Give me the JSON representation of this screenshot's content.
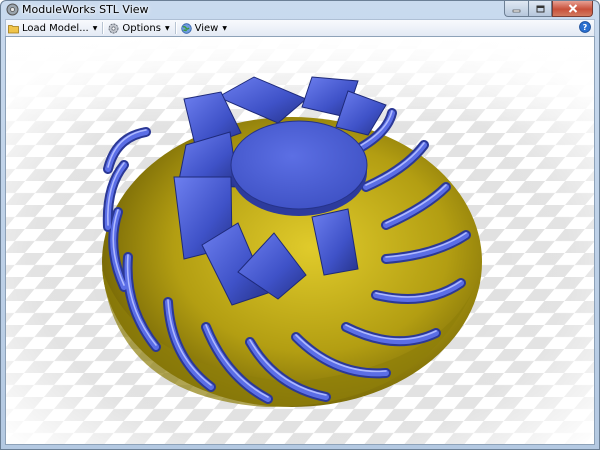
{
  "window": {
    "title": "ModuleWorks STL View"
  },
  "toolbar": {
    "load_model_label": "Load Model...",
    "options_label": "Options",
    "view_label": "View",
    "dropdown_arrow": "▼"
  },
  "icons": {
    "app": "gear-app-icon",
    "load": "folder-icon",
    "options": "gear-icon",
    "view": "globe-icon",
    "help": "help-icon"
  },
  "colors": {
    "blade": "#4a5ed8",
    "hub": "#b9a414",
    "floor": "#dcdcdc"
  }
}
